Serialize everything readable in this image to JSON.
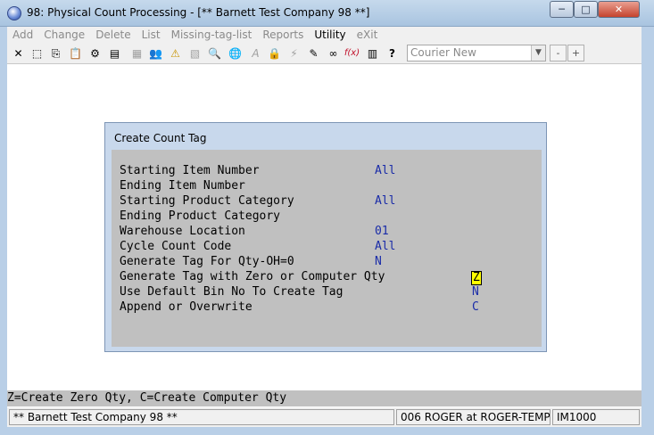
{
  "window": {
    "title": "98: Physical Count Processing - [** Barnett Test Company 98 **]",
    "min_glyph": "─",
    "max_glyph": "□",
    "close_glyph": "✕"
  },
  "menu": {
    "items": [
      "Add",
      "Change",
      "Delete",
      "List",
      "Missing-tag-list",
      "Reports",
      "Utility",
      "eXit"
    ],
    "active": "Utility"
  },
  "toolbar": {
    "font_name": "Courier New",
    "dropdown_glyph": "▼",
    "size_minus": "-",
    "size_plus": "+",
    "icons": {
      "exit": "✕",
      "select": "⬚",
      "copy": "⎘",
      "paste": "📋",
      "settings": "⚙",
      "properties": "▤",
      "notes": "▦",
      "users": "👥",
      "alert": "⚠",
      "image": "▧",
      "search": "🔍",
      "globe": "🌐",
      "font": "A",
      "audit": "🔒",
      "macro": "⚡",
      "report": "✎",
      "link": "∞",
      "function": "f(x)",
      "calculator": "▥",
      "help": "?"
    }
  },
  "dialog": {
    "title": "Create Count Tag",
    "fields": [
      {
        "label": "Starting Item Number",
        "value": "All"
      },
      {
        "label": "Ending Item Number",
        "value": ""
      },
      {
        "label": "Starting Product Category",
        "value": "All"
      },
      {
        "label": "Ending Product Category",
        "value": ""
      },
      {
        "label": "Warehouse Location",
        "value": "01"
      },
      {
        "label": "Cycle Count Code",
        "value": "All"
      },
      {
        "label": "Generate Tag For Qty-OH=0",
        "value": "N"
      },
      {
        "label": "Generate Tag with Zero or Computer Qty",
        "value": "Z"
      },
      {
        "label": "Use Default Bin No To Create Tag",
        "value": "N"
      },
      {
        "label": "Append or Overwrite",
        "value": "C"
      }
    ]
  },
  "prompt": "Z=Create Zero Qty, C=Create Computer Qty",
  "status": {
    "company": "** Barnett Test Company 98 **",
    "user": "006 ROGER at ROGER-TEMP",
    "module": "IM1000"
  },
  "colors": {
    "field_value": "#1a2ca8",
    "active_field_bg": "#ffff00",
    "dialog_body": "#c0c0c0",
    "dialog_frame": "#c8d8ec"
  }
}
